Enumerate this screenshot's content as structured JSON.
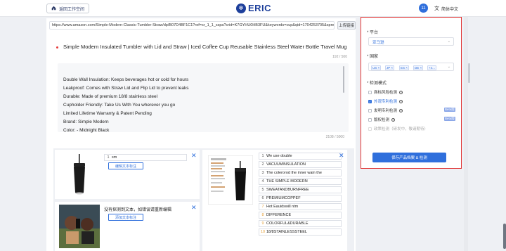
{
  "header": {
    "back_label": "返回工作空间",
    "logo_text": "ERIC",
    "user_initials": "11",
    "language": "简体中文"
  },
  "url": {
    "value": "https://www.amazon.com/Simple-Modern-Classic-Tumbler-Straw/dp/B07D4BF1C1?ref=sr_1_1_sspa?crid=K7GYHU0HB3FU&keywords=cup&qid=1704253705&sprefix=",
    "upload_label": "上传链接"
  },
  "product": {
    "title": "Simple Modern Insulated Tumbler with Lid and Straw | Iced Coffee Cup Reusable Stainless Steel Water Bottle Travel Mug | Gifts for W",
    "title_count": "192 / 500",
    "bullets": [
      "Double Wall Insulation: Keeps beverages hot or cold for hours",
      "Leakproof: Comes with Straw Lid and Flip Lid to prevent leaks",
      "Durable: Made of premium 18/8 stainless steel",
      "Cupholder Friendly: Take Us With You wherever you go",
      "Limited Lifetime Warranty & Patent Pending",
      "Brand: Simple Modern",
      "Color: - Midnight Black"
    ],
    "bullets_count": "2108 / 5000"
  },
  "images": {
    "card1": {
      "kw_num": "1",
      "kw_text": "sm",
      "edit_label": "编辑文本标注"
    },
    "card2": {
      "notice": "没有探测到文本，如错误请重新编辑",
      "add_label": "添加文本标注"
    },
    "card3": {
      "keywords": [
        {
          "num": "1",
          "text": "We use double"
        },
        {
          "num": "2",
          "text": "VACUUMINSULATION"
        },
        {
          "num": "3",
          "text": "The colerorod the inner wain the"
        },
        {
          "num": "4",
          "text": "THE SIMPLE MODERN"
        },
        {
          "num": "5",
          "text": "SWEATANDBURNFREE"
        },
        {
          "num": "6",
          "text": "PREMIUMCOPPEF"
        },
        {
          "num": "7",
          "text": "Hot Eauidswill ntm"
        },
        {
          "num": "8",
          "text": "DIFFERENCE"
        },
        {
          "num": "9",
          "text": "COLORFUL&DURABLE"
        },
        {
          "num": "10",
          "text": "18/8STAINLESSSTEEL"
        }
      ]
    }
  },
  "settings": {
    "platform_title": "平台",
    "platform_value": "亚马逊",
    "country_title": "国家",
    "countries": [
      "US ×",
      "JP ×",
      "ES ×",
      "DE ×",
      "+4..."
    ],
    "mode_title": "检测模式",
    "options": [
      {
        "label": "商标风险检测",
        "checked": false,
        "beta": ""
      },
      {
        "label": "外观专利检测",
        "checked": true,
        "beta": ""
      },
      {
        "label": "发明专利检测",
        "checked": false,
        "beta": "Beta版"
      },
      {
        "label": "版权检测",
        "checked": false,
        "beta": "Beta版"
      },
      {
        "label": "政策检测（研发中，敬请期待）",
        "checked": false,
        "beta": ""
      }
    ],
    "save_label": "保存产品档案 & 检测"
  },
  "colors": {
    "accent": "#2f6fdc",
    "highlight_border": "#e03131",
    "brand": "#1d3f9b"
  }
}
